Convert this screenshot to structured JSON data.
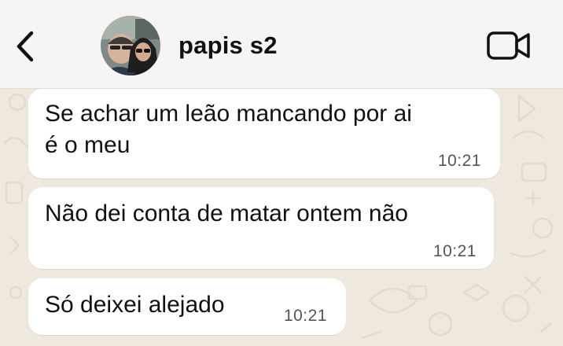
{
  "header": {
    "contact_name": "papis s2",
    "back_icon": "chevron-left-icon",
    "call_icon": "video-camera-icon"
  },
  "messages": [
    {
      "text": "Se achar um leão mancando por ai\né o meu",
      "time": "10:21"
    },
    {
      "text": "Não dei conta de matar ontem não",
      "time": "10:21"
    },
    {
      "text": "Só deixei alejado",
      "time": "10:21"
    }
  ],
  "colors": {
    "header_bg": "#f6f5f3",
    "wallpaper_bg": "#efe8df",
    "bubble_bg": "#ffffff"
  }
}
